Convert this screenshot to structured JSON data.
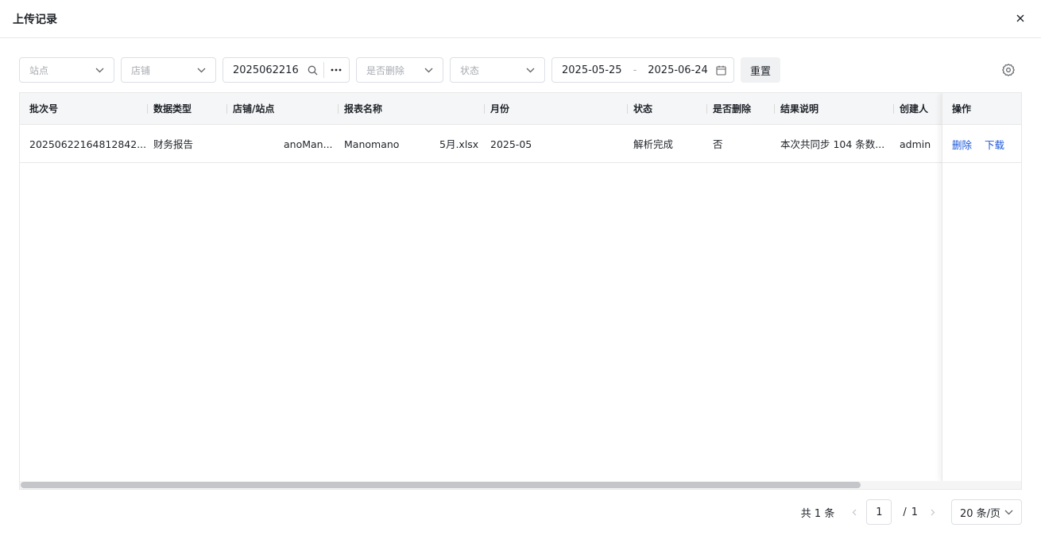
{
  "modal": {
    "title": "上传记录"
  },
  "filters": {
    "site_placeholder": "站点",
    "shop_placeholder": "店铺",
    "batch_value": "2025062216",
    "deleted_placeholder": "是否删除",
    "status_placeholder": "状态",
    "date_start": "2025-05-25",
    "date_sep": "-",
    "date_end": "2025-06-24",
    "reset_label": "重置"
  },
  "table": {
    "columns": [
      "批次号",
      "数据类型",
      "店铺/站点",
      "报表名称",
      "月份",
      "状态",
      "是否删除",
      "结果说明",
      "创建人"
    ],
    "action_header": "操作",
    "rows": [
      {
        "batch": "20250622164812842...",
        "type": "财务报告",
        "shop": "anoMan...",
        "report_prefix": "Manomano",
        "report_suffix": "5月.xlsx",
        "month": "2025-05",
        "status": "解析完成",
        "deleted": "否",
        "result": "本次共同步 104 条数...",
        "creator": "admin",
        "actions": {
          "delete": "删除",
          "download": "下载"
        }
      }
    ]
  },
  "pagination": {
    "total": "共 1 条",
    "current": "1",
    "slash": "/",
    "pages": "1",
    "page_size": "20 条/页",
    "scroll_fraction": 0.84
  },
  "colors": {
    "link": "#1a56db",
    "header_bg": "#f5f6f7",
    "border": "#e8e8e8"
  }
}
